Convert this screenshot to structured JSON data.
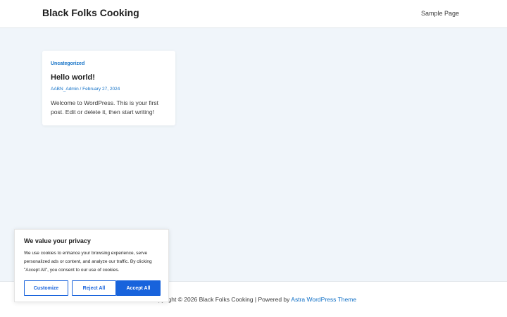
{
  "header": {
    "site_title": "Black Folks Cooking",
    "nav": [
      "Sample Page"
    ]
  },
  "post": {
    "category": "Uncategorized",
    "title": "Hello world!",
    "author": "AABN_Admin",
    "separator": " / ",
    "date": "February 27, 2024",
    "excerpt": "Welcome to WordPress. This is your first post. Edit or delete it, then start writing!"
  },
  "footer": {
    "text": "Copyright © 2026 Black Folks Cooking | Powered by ",
    "theme_link": "Astra WordPress Theme"
  },
  "cookie_banner": {
    "title": "We value your privacy",
    "text": "We use cookies to enhance your browsing experience, serve personalized ads or content, and analyze our traffic. By clicking \"Accept All\", you consent to our use of cookies.",
    "buttons": {
      "customize": "Customize",
      "reject": "Reject All",
      "accept": "Accept All"
    }
  },
  "colors": {
    "accent": "#0f6fc6",
    "page_bg": "#f0f5fa",
    "cookie_primary": "#1863dc"
  }
}
